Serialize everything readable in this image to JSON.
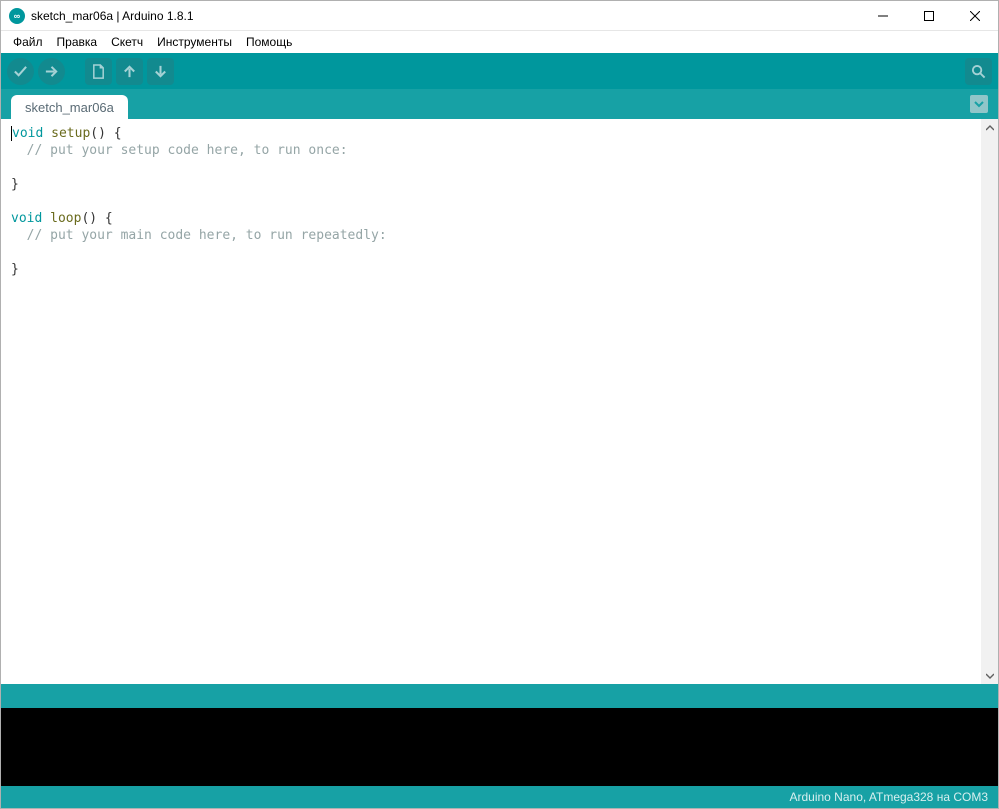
{
  "window": {
    "title": "sketch_mar06a | Arduino 1.8.1"
  },
  "menu": {
    "file": "Файл",
    "edit": "Правка",
    "sketch": "Скетч",
    "tools": "Инструменты",
    "help": "Помощь"
  },
  "tab": {
    "name": "sketch_mar06a"
  },
  "code": {
    "l1_kw": "void",
    "l1_fn": " setup",
    "l1_rest": "() {",
    "l2_cm": "  // put your setup code here, to run once:",
    "l3": "",
    "l4": "}",
    "l5": "",
    "l6_kw": "void",
    "l6_fn": " loop",
    "l6_rest": "() {",
    "l7_cm": "  // put your main code here, to run repeatedly:",
    "l8": "",
    "l9": "}"
  },
  "status": {
    "board": "Arduino Nano, ATmega328 на COM3"
  }
}
